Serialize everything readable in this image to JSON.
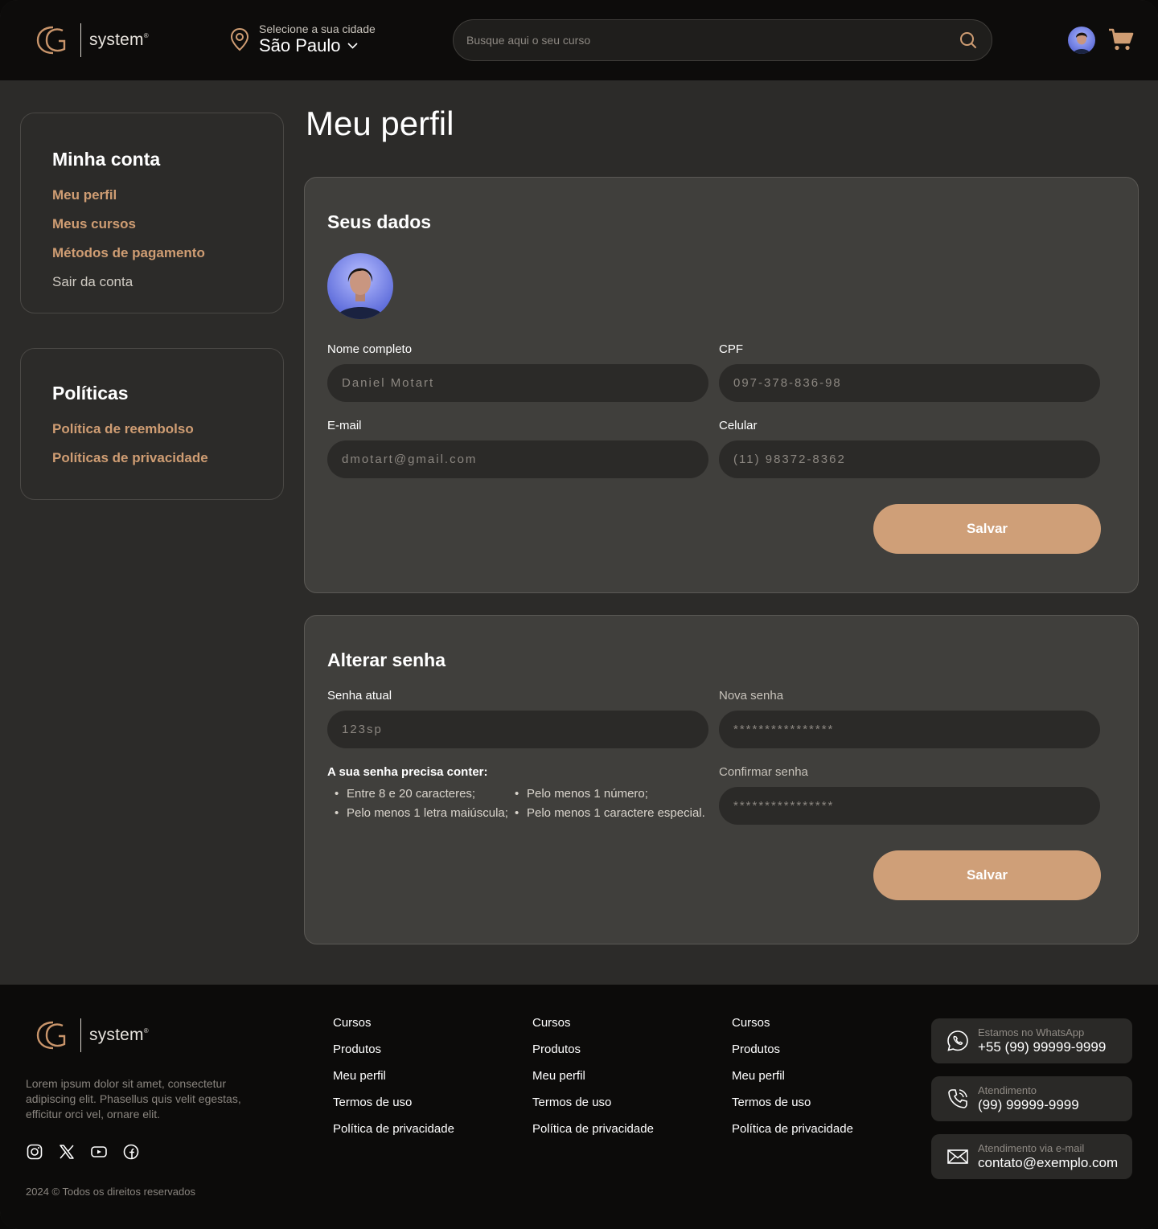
{
  "brand": {
    "name": "system",
    "trademark": "®"
  },
  "header": {
    "city_hint": "Selecione a sua cidade",
    "city_name": "São Paulo",
    "search_placeholder": "Busque aqui o seu curso",
    "icons": [
      "location-pin-icon",
      "chevron-down-icon",
      "search-icon",
      "avatar",
      "cart-icon"
    ]
  },
  "sidebar": {
    "account": {
      "title": "Minha conta",
      "items": [
        {
          "label": "Meu perfil",
          "active": true
        },
        {
          "label": "Meus cursos",
          "active": true
        },
        {
          "label": "Métodos de pagamento",
          "active": true
        },
        {
          "label": "Sair da conta",
          "active": false
        }
      ]
    },
    "policies": {
      "title": "Políticas",
      "items": [
        {
          "label": "Política de reembolso"
        },
        {
          "label": "Políticas de privacidade"
        }
      ]
    }
  },
  "main": {
    "page_title": "Meu perfil",
    "profile": {
      "title": "Seus dados",
      "name_label": "Nome completo",
      "name_placeholder": "Daniel Motart",
      "cpf_label": "CPF",
      "cpf_placeholder": "097-378-836-98",
      "email_label": "E-mail",
      "email_placeholder": "dmotart@gmail.com",
      "phone_label": "Celular",
      "phone_placeholder": "(11) 98372-8362",
      "save_label": "Salvar"
    },
    "password": {
      "title": "Alterar senha",
      "current_label": "Senha atual",
      "current_placeholder": "123sp",
      "new_label": "Nova senha",
      "new_placeholder": "****************",
      "confirm_label": "Confirmar senha",
      "confirm_placeholder": "****************",
      "rules_title": "A sua senha precisa conter:",
      "rules": [
        "Entre 8 e 20 caracteres;",
        "Pelo menos 1 letra maiúscula;",
        "Pelo menos 1 número;",
        "Pelo menos 1 caractere especial."
      ],
      "save_label": "Salvar"
    }
  },
  "footer": {
    "description": "Lorem ipsum dolor sit amet, consectetur adipiscing elit. Phasellus quis velit egestas, efficitur orci vel, ornare elit.",
    "copyright": "2024 © Todos os direitos reservados",
    "socials": [
      "instagram-icon",
      "x-icon",
      "youtube-icon",
      "facebook-icon"
    ],
    "columns": [
      [
        "Cursos",
        "Produtos",
        "Meu perfil",
        "Termos de uso",
        "Política de privacidade"
      ],
      [
        "Cursos",
        "Produtos",
        "Meu perfil",
        "Termos de uso",
        "Política de privacidade"
      ],
      [
        "Cursos",
        "Produtos",
        "Meu perfil",
        "Termos de uso",
        "Política de privacidade"
      ]
    ],
    "contacts": [
      {
        "icon": "whatsapp-icon",
        "title": "Estamos no WhatsApp",
        "value": "+55 (99) 99999-9999"
      },
      {
        "icon": "phone-icon",
        "title": "Atendimento",
        "value": "(99) 99999-9999"
      },
      {
        "icon": "mail-icon",
        "title": "Atendimento via e-mail",
        "value": "contato@exemplo.com"
      }
    ]
  },
  "colors": {
    "accent": "#cf9d73",
    "button": "#cf9f78",
    "header_bg": "#0d0c0b",
    "page_bg": "#2c2b29",
    "panel_bg": "#403f3c",
    "field_bg": "#2b2a28"
  }
}
